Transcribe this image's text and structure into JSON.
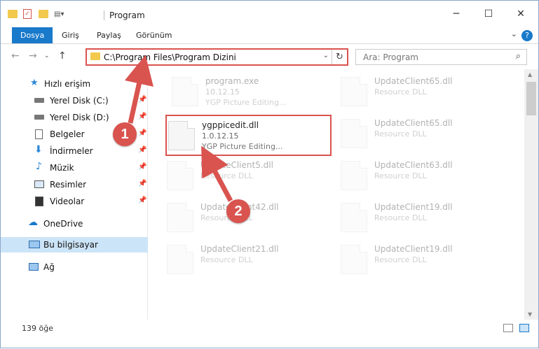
{
  "window": {
    "title": "Program"
  },
  "ribbon": {
    "tabs": [
      "Dosya",
      "Giriş",
      "Paylaş",
      "Görünüm"
    ]
  },
  "address": {
    "path": "C:\\Program Files\\Program Dizini"
  },
  "search": {
    "placeholder": "Ara: Program"
  },
  "nav": {
    "items": [
      {
        "label": "Hızlı erişim",
        "icon": "star-icon"
      },
      {
        "label": "Yerel Disk (C:)",
        "icon": "drive-icon",
        "pinned": true
      },
      {
        "label": "Yerel Disk (D:)",
        "icon": "drive-icon",
        "pinned": true
      },
      {
        "label": "Belgeler",
        "icon": "documents-icon",
        "pinned": true
      },
      {
        "label": "İndirmeler",
        "icon": "download-icon",
        "pinned": true
      },
      {
        "label": "Müzik",
        "icon": "music-icon",
        "pinned": true
      },
      {
        "label": "Resimler",
        "icon": "pictures-icon",
        "pinned": true
      },
      {
        "label": "Videolar",
        "icon": "videos-icon",
        "pinned": true
      },
      {
        "label": "OneDrive",
        "icon": "cloud-icon"
      },
      {
        "label": "Bu bilgisayar",
        "icon": "computer-icon",
        "selected": true
      },
      {
        "label": "Ağ",
        "icon": "network-icon"
      }
    ]
  },
  "files": {
    "left": [
      {
        "name": "program.exe",
        "version": "10.12.15",
        "desc": "YGP Picture Editing..."
      },
      {
        "name": "ygppicedit.dll",
        "version": "1.0.12.15",
        "desc": "YGP Picture Editing..."
      },
      {
        "name": "UpdateClient5.dll",
        "desc": "Resource DLL"
      },
      {
        "name": "UpdateClient42.dll",
        "desc": "Resource DLL"
      },
      {
        "name": "UpdateClient21.dll",
        "desc": "Resource DLL"
      }
    ],
    "right": [
      {
        "name": "UpdateClient65.dll",
        "desc": "Resource DLL"
      },
      {
        "name": "UpdateClient65.dll",
        "desc": "Resource DLL"
      },
      {
        "name": "UpdateClient63.dll",
        "desc": "Resource DLL"
      },
      {
        "name": "UpdateClient19.dll",
        "desc": "Resource DLL"
      },
      {
        "name": "UpdateClient19.dll",
        "desc": "Resource DLL"
      }
    ]
  },
  "status": {
    "count": "139 öğe"
  },
  "annotations": {
    "step1": "1",
    "step2": "2"
  },
  "colors": {
    "accent": "#1979ca",
    "highlight": "#d9534f"
  }
}
